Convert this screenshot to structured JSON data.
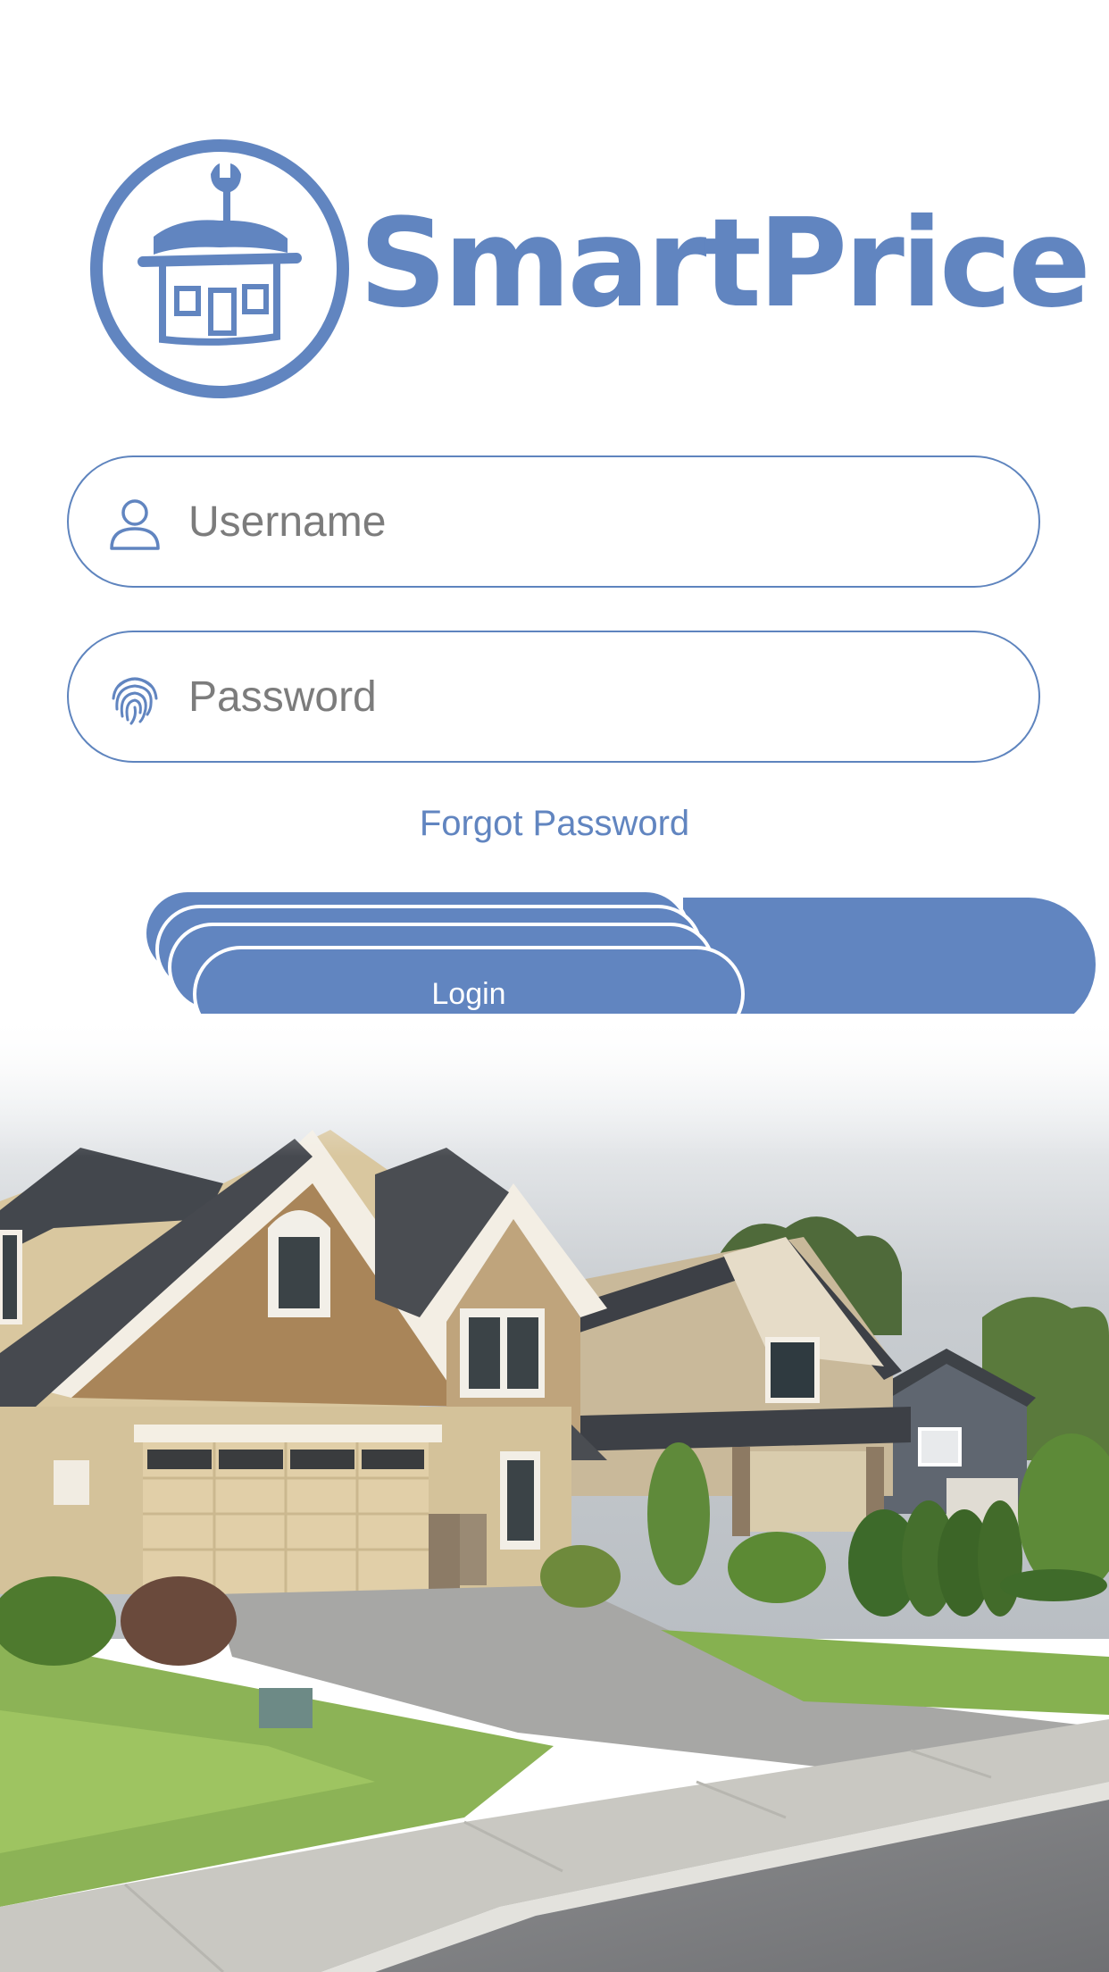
{
  "brand": {
    "name": "SmartPrice",
    "logo_icon": "house-wrench-icon"
  },
  "login_form": {
    "username": {
      "placeholder": "Username",
      "value": "",
      "icon": "user-icon"
    },
    "password": {
      "placeholder": "Password",
      "value": "",
      "icon": "fingerprint-icon"
    },
    "forgot_password_label": "Forgot Password",
    "login_label": "Login"
  },
  "colors": {
    "accent": "#6185c0",
    "field_border": "#5e84be",
    "placeholder": "#7c7c7c",
    "background": "#ffffff"
  },
  "background_image": "suburban-houses-photo"
}
